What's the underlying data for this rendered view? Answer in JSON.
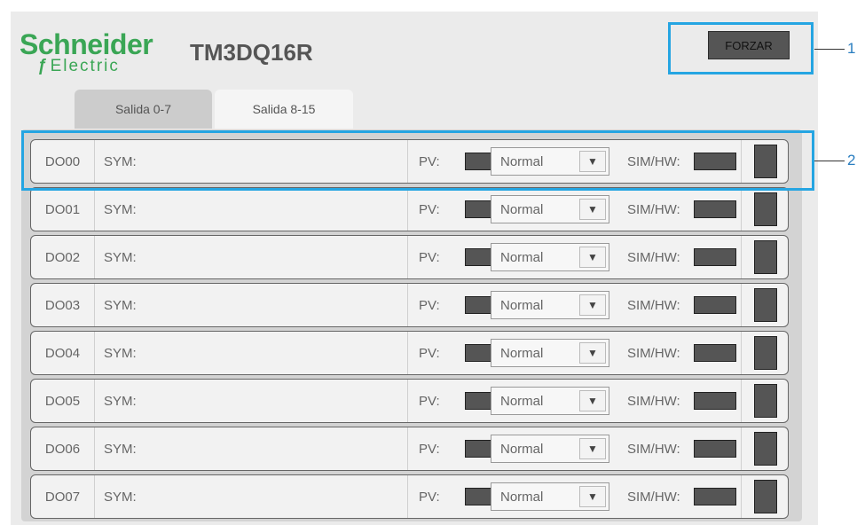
{
  "brand": {
    "name_top": "Schneider",
    "name_bottom": "Electric",
    "accent_color": "#3aa655"
  },
  "module": {
    "model": "TM3DQ16R"
  },
  "toolbar": {
    "force_label": "FORZAR"
  },
  "tabs": [
    {
      "label": "Salida 0-7",
      "active": true
    },
    {
      "label": "Salida 8-15",
      "active": false
    }
  ],
  "labels": {
    "sym": "SYM:",
    "pv": "PV:",
    "simhw": "SIM/HW:"
  },
  "rows": [
    {
      "id": "DO00",
      "mode": "Normal"
    },
    {
      "id": "DO01",
      "mode": "Normal"
    },
    {
      "id": "DO02",
      "mode": "Normal"
    },
    {
      "id": "DO03",
      "mode": "Normal"
    },
    {
      "id": "DO04",
      "mode": "Normal"
    },
    {
      "id": "DO05",
      "mode": "Normal"
    },
    {
      "id": "DO06",
      "mode": "Normal"
    },
    {
      "id": "DO07",
      "mode": "Normal"
    }
  ],
  "callouts": [
    "1",
    "2"
  ],
  "icons": {
    "dropdown": "chevron-down-icon"
  },
  "colors": {
    "callout": "#25a5e2",
    "indicator": "#555555"
  }
}
